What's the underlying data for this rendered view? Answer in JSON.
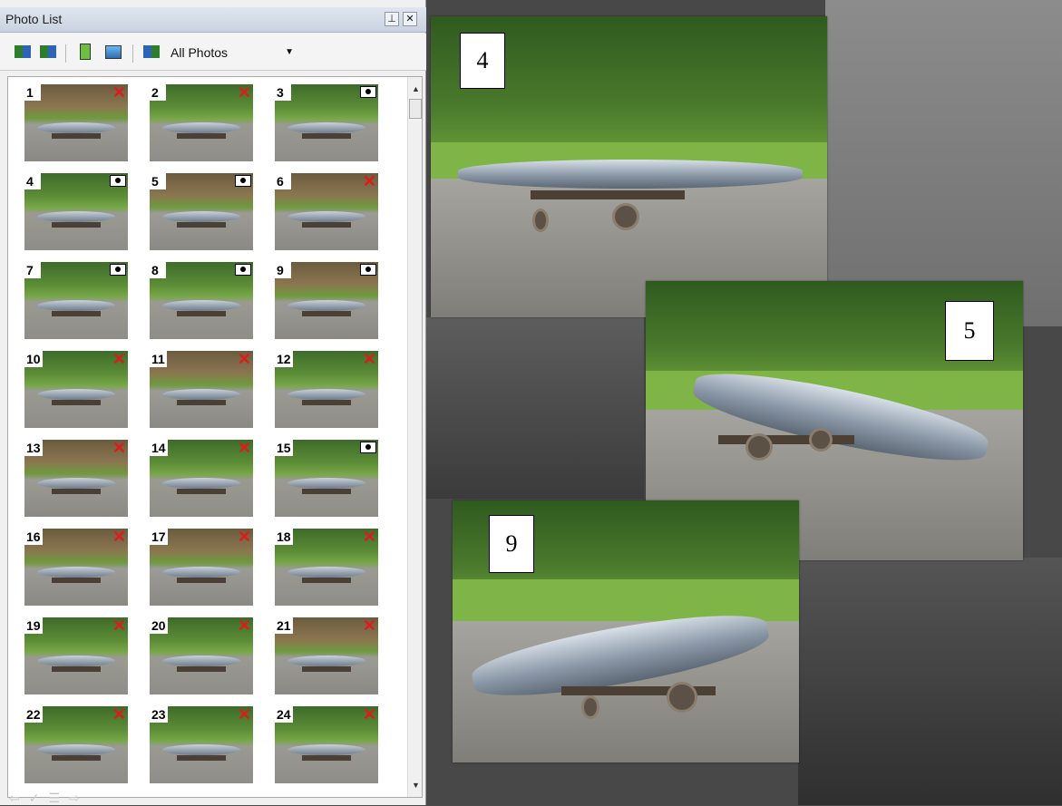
{
  "panel": {
    "title": "Photo List",
    "pin_glyph": "⊥",
    "close_glyph": "✕",
    "filter": {
      "selected": "All Photos"
    },
    "toolbar_icons": [
      "add-photos-icon",
      "add-photos-alt-icon",
      "properties-icon",
      "remove-photo-icon",
      "filter-icon"
    ]
  },
  "photos": [
    {
      "n": "1",
      "status": "x"
    },
    {
      "n": "2",
      "status": "x"
    },
    {
      "n": "3",
      "status": "camera"
    },
    {
      "n": "4",
      "status": "camera"
    },
    {
      "n": "5",
      "status": "camera"
    },
    {
      "n": "6",
      "status": "x"
    },
    {
      "n": "7",
      "status": "camera"
    },
    {
      "n": "8",
      "status": "camera"
    },
    {
      "n": "9",
      "status": "camera"
    },
    {
      "n": "10",
      "status": "x"
    },
    {
      "n": "11",
      "status": "x"
    },
    {
      "n": "12",
      "status": "x"
    },
    {
      "n": "13",
      "status": "x"
    },
    {
      "n": "14",
      "status": "x"
    },
    {
      "n": "15",
      "status": "camera"
    },
    {
      "n": "16",
      "status": "x"
    },
    {
      "n": "17",
      "status": "x"
    },
    {
      "n": "18",
      "status": "x"
    },
    {
      "n": "19",
      "status": "x"
    },
    {
      "n": "20",
      "status": "x"
    },
    {
      "n": "21",
      "status": "x"
    },
    {
      "n": "22",
      "status": "x"
    },
    {
      "n": "23",
      "status": "x"
    },
    {
      "n": "24",
      "status": "x"
    }
  ],
  "viewport": {
    "labels": {
      "photo_4": "4",
      "photo_5": "5",
      "photo_9": "9"
    }
  },
  "colors": {
    "x_mark": "#e01a1a",
    "titlebar": "#d4dce6"
  }
}
